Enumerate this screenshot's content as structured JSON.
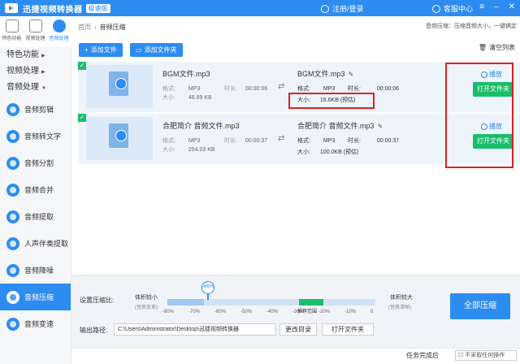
{
  "app": {
    "title": "迅捷视频转换器",
    "edition": "极速版",
    "login_label": "注册/登录",
    "service_label": "客服中心"
  },
  "top_tabs": [
    {
      "label": "特色功能",
      "icon": "grid-icon"
    },
    {
      "label": "视频处理",
      "icon": "film-icon"
    },
    {
      "label": "音频处理",
      "icon": "music-icon"
    }
  ],
  "sidebar": {
    "categories": [
      "特色功能",
      "视频处理",
      "音频处理"
    ],
    "items": [
      "音频剪辑",
      "音频转文字",
      "音频分割",
      "音频合并",
      "音频提取",
      "人声伴奏提取",
      "音频降噪",
      "音频压缩",
      "音频变速"
    ]
  },
  "breadcrumb": {
    "home": "首页",
    "current": "音频压缩",
    "hint": "音频压缩：压缩音频大小，一键搞定"
  },
  "actions": {
    "add_file": "添加文件",
    "add_folder": "添加文件夹",
    "clear_list": "清空列表"
  },
  "files": [
    {
      "src_name": "BGM文件.mp3",
      "format_label": "格式:",
      "format": "MP3",
      "duration_label": "时长:",
      "duration": "00:00:06",
      "size_label": "大小:",
      "size": "48.89 KB",
      "dst_name": "BGM文件.mp3",
      "dst_format": "MP3",
      "dst_duration": "00:00:06",
      "dst_size": "16.6KB",
      "estimate": "(预估)",
      "play_label": "播放",
      "open_folder": "打开文件夹"
    },
    {
      "src_name": "合肥简介 音频文件.mp3",
      "format_label": "格式:",
      "format": "MP3",
      "duration_label": "时长:",
      "duration": "00:00:37",
      "size_label": "大小:",
      "size": "294.03 KB",
      "dst_name": "合肥简介 音频文件.mp3",
      "dst_format": "MP3",
      "dst_duration": "00:00:37",
      "dst_size": "100.0KB",
      "estimate": "(预估)",
      "play_label": "播放",
      "open_folder": "打开文件夹"
    }
  ],
  "compression": {
    "label": "设置压缩比:",
    "small_label": "体积较小",
    "small_sub": "(音质变差)",
    "large_label": "体积较大",
    "large_sub": "(音质清晰)",
    "value_label": "-66%",
    "value": -66,
    "recommend": "推荐范围",
    "ticks": [
      "-80%",
      "-70%",
      "-60%",
      "-50%",
      "-40%",
      "-30%",
      "-20%",
      "-10%",
      "0"
    ]
  },
  "output": {
    "label": "输出路径:",
    "path": "C:\\Users\\Administrator\\Desktop\\迅捷视频转换器",
    "change_dir": "更改目录",
    "open_folder": "打开文件夹"
  },
  "compress_all": "全部压缩",
  "status": {
    "task_done": "任务完成后",
    "after_action": "不采取任何操作"
  },
  "colors": {
    "primary": "#2d8cf0",
    "success": "#19be6b",
    "annotation": "#e02020"
  }
}
